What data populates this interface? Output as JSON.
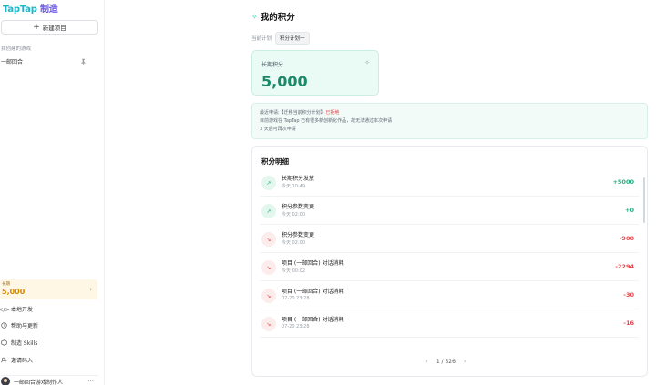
{
  "brand": {
    "name_left": "TapTap",
    "name_right": "制造"
  },
  "sidebar": {
    "new_project_label": "新建项目",
    "section_label": "我创建的游戏",
    "projects": [
      {
        "name": "一邮回合"
      }
    ],
    "credits": {
      "caption": "长期",
      "value": "5,000"
    },
    "menu": [
      {
        "label": "本地开发",
        "icon": "code-icon"
      },
      {
        "label": "帮助与更新",
        "icon": "help-icon"
      },
      {
        "label": "制造 Skills",
        "icon": "skills-icon"
      },
      {
        "label": "邀请码入",
        "icon": "invite-icon"
      }
    ],
    "user": {
      "name": "一邮回合游戏制作人"
    }
  },
  "main": {
    "title": "我的积分",
    "plan_label": "当前计划",
    "plan_value": "积分计划一",
    "long_term": {
      "caption": "长期积分",
      "value": "5,000"
    },
    "notice": {
      "line1_prefix": "最近申请:【迁移当前积分计划】· ",
      "line1_status": "已拒绝",
      "line2": "目前游戏在 TapTap 已有很多新创新化作品，故无法通过本次申请",
      "line3": "3 天后可再次申请"
    },
    "details": {
      "heading": "积分明细",
      "rows": [
        {
          "title": "长期积分发放",
          "time": "今天 10:49",
          "amount": "+5000",
          "direction": "up"
        },
        {
          "title": "积分参数变更",
          "time": "今天 02:00",
          "amount": "+0",
          "direction": "up"
        },
        {
          "title": "积分参数变更",
          "time": "今天 02:00",
          "amount": "-900",
          "direction": "down"
        },
        {
          "title": "项目 (一邮回合) 对话消耗",
          "time": "今天 00:02",
          "amount": "-2294",
          "direction": "down"
        },
        {
          "title": "项目 (一邮回合) 对话消耗",
          "time": "07-20 23:28",
          "amount": "-30",
          "direction": "down"
        },
        {
          "title": "项目 (一邮回合) 对话消耗",
          "time": "07-20 23:28",
          "amount": "-16",
          "direction": "down"
        }
      ],
      "pager": {
        "text": "1 / 526"
      }
    }
  }
}
